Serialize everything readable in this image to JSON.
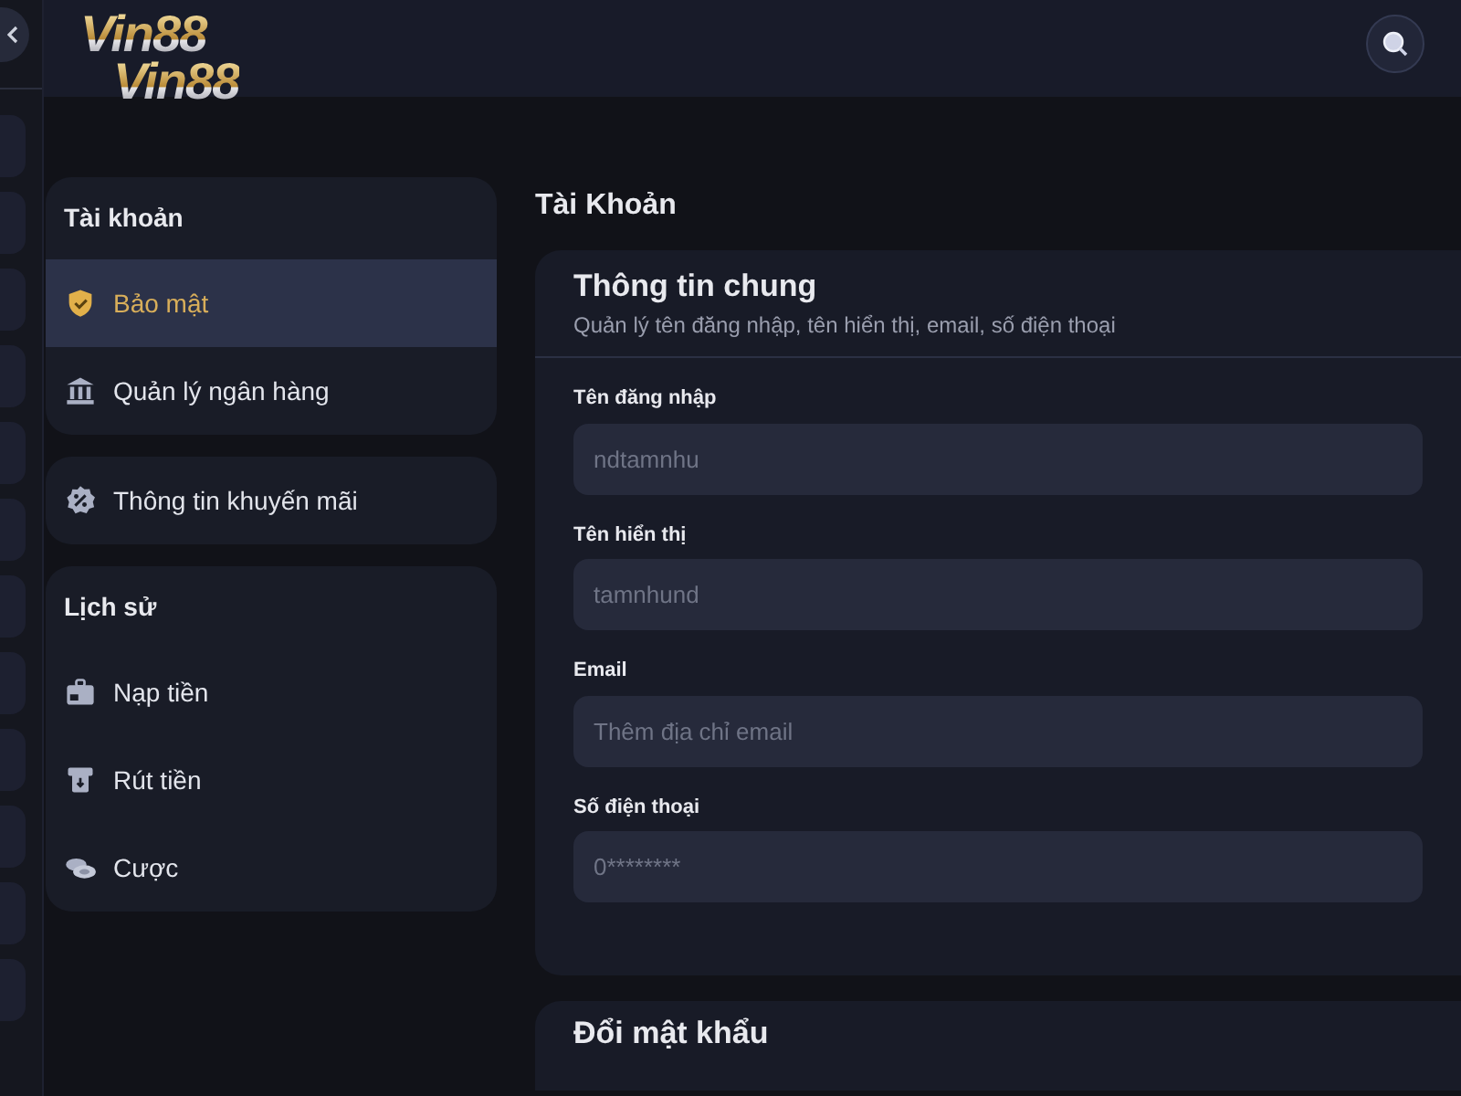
{
  "logo": {
    "lines": [
      "Vin88",
      "Vin88"
    ]
  },
  "sidebar": {
    "groups": [
      {
        "title": "Tài khoản",
        "items": [
          {
            "label": "Bảo mật",
            "kind": "shield",
            "selected": true
          },
          {
            "label": "Quản lý ngân hàng",
            "kind": "bank",
            "selected": false
          }
        ]
      },
      {
        "items": [
          {
            "label": "Thông tin khuyến mãi",
            "kind": "promo",
            "selected": false
          }
        ]
      },
      {
        "title": "Lịch sử",
        "items": [
          {
            "label": "Nạp tiền",
            "kind": "deposit",
            "selected": false
          },
          {
            "label": "Rút tiền",
            "kind": "withdraw",
            "selected": false
          },
          {
            "label": "Cược",
            "kind": "bet",
            "selected": false
          }
        ]
      }
    ]
  },
  "page_title": "Tài Khoản",
  "general_card": {
    "title": "Thông tin chung",
    "subtitle": "Quản lý tên đăng nhập, tên hiển thị, email, số điện thoại",
    "fields": [
      {
        "label": "Tên đăng nhập",
        "value": "ndtamnhu"
      },
      {
        "label": "Tên hiển thị",
        "value": "tamnhund"
      },
      {
        "label": "Email",
        "placeholder": "Thêm địa chỉ email"
      },
      {
        "label": "Số điện thoại",
        "value": "0********"
      }
    ]
  },
  "password_card": {
    "title": "Đổi mật khẩu"
  }
}
